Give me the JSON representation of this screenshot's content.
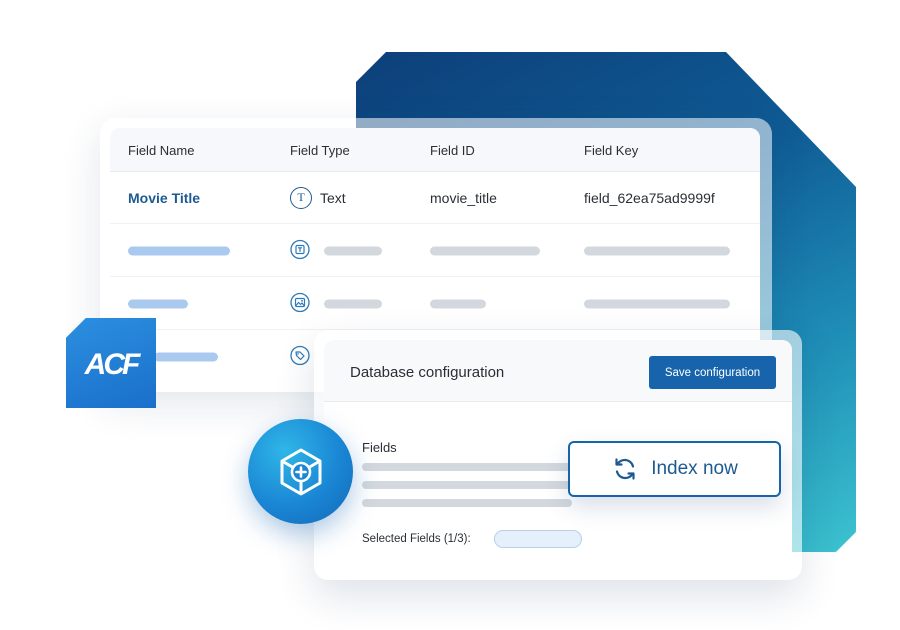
{
  "table": {
    "headers": [
      "Field Name",
      "Field Type",
      "Field ID",
      "Field Key"
    ],
    "first_row": {
      "name": "Movie Title",
      "type_icon": "T",
      "type": "Text",
      "id": "movie_title",
      "key": "field_62ea75ad9999f"
    },
    "placeholder_rows": [
      {
        "type_icon": "text-box-icon"
      },
      {
        "type_icon": "image-icon"
      },
      {
        "type_icon": "tag-icon"
      }
    ]
  },
  "logo": {
    "text": "ACF"
  },
  "db_config": {
    "title": "Database configuration",
    "save_label": "Save configuration",
    "fields_label": "Fields",
    "selected_label": "Selected Fields (1/3):"
  },
  "index_button": {
    "label": "Index now",
    "icon": "refresh-icon"
  },
  "cube": {
    "icon": "cube-plus-icon"
  },
  "colors": {
    "accent": "#1764ad",
    "link": "#1d5a91",
    "bg_gradient_start": "#0d3f7a",
    "bg_gradient_end": "#3cc3cf",
    "placeholder_gray": "#d3d8de",
    "placeholder_blue": "#a9c9ee"
  }
}
